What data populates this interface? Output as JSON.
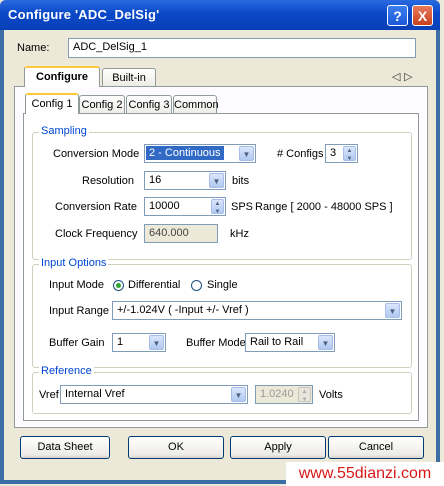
{
  "window": {
    "title": "Configure 'ADC_DelSig'",
    "help_glyph": "?",
    "close_glyph": "X"
  },
  "name": {
    "label": "Name:",
    "value": "ADC_DelSig_1"
  },
  "main_tabs": [
    {
      "label": "Configure"
    },
    {
      "label": "Built-in"
    }
  ],
  "main_tabs_nav": {
    "left": "◁",
    "right": "▷"
  },
  "config_tabs": [
    {
      "label": "Config 1"
    },
    {
      "label": "Config 2"
    },
    {
      "label": "Config 3"
    },
    {
      "label": "Common"
    }
  ],
  "sampling": {
    "title": "Sampling",
    "conversion_mode": {
      "label": "Conversion Mode",
      "value": "2 - Continuous"
    },
    "num_configs": {
      "label": "# Configs",
      "value": "3"
    },
    "resolution": {
      "label": "Resolution",
      "value": "16",
      "unit": "bits"
    },
    "conversion_rate": {
      "label": "Conversion Rate",
      "value": "10000",
      "unit": "SPS",
      "range": "Range [ 2000 - 48000 SPS ]"
    },
    "clock_frequency": {
      "label": "Clock Frequency",
      "value": "640.000",
      "unit": "kHz"
    }
  },
  "input_options": {
    "title": "Input Options",
    "input_mode": {
      "label": "Input Mode",
      "options": [
        "Differential",
        "Single"
      ],
      "selected": "Differential"
    },
    "input_range": {
      "label": "Input Range",
      "value": "+/-1.024V ( -Input +/- Vref )"
    },
    "buffer_gain": {
      "label": "Buffer Gain",
      "value": "1"
    },
    "buffer_mode": {
      "label": "Buffer Mode",
      "value": "Rail to Rail"
    }
  },
  "reference": {
    "title": "Reference",
    "vref": {
      "label": "Vref",
      "value": "Internal Vref"
    },
    "voltage": {
      "value": "1.0240",
      "unit": "Volts"
    }
  },
  "buttons": {
    "datasheet": "Data Sheet",
    "ok": "OK",
    "apply": "Apply",
    "cancel": "Cancel"
  },
  "watermark": "www.55dianzi.com",
  "colors": {
    "titlebar": "#0a48c8",
    "group_title": "#0046d5",
    "selection": "#316ac5",
    "watermark": "#d81818"
  }
}
